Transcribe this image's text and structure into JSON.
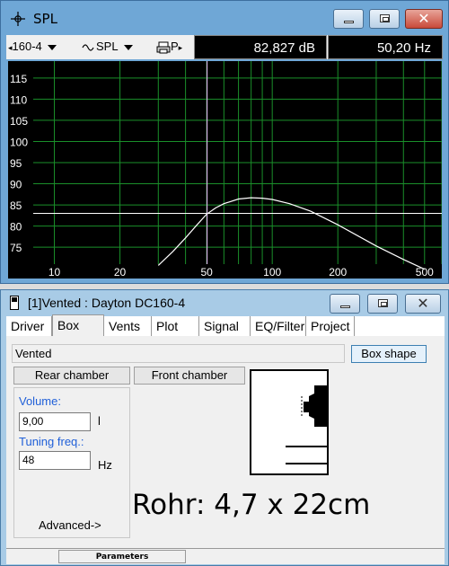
{
  "spl_window": {
    "title": "SPL",
    "toolbar": {
      "driver_select": "160-4",
      "view_select": "SPL",
      "print_label": "P",
      "spl_readout": "82,827 dB",
      "freq_readout": "50,20 Hz"
    }
  },
  "chart_data": {
    "type": "line",
    "xscale": "log",
    "xlim": [
      8,
      600
    ],
    "ylim": [
      71,
      119
    ],
    "x_ticks": [
      "10",
      "20",
      "50",
      "100",
      "200",
      "500"
    ],
    "y_ticks": [
      "115",
      "110",
      "105",
      "100",
      "95",
      "90",
      "85",
      "80",
      "75"
    ],
    "grid": true,
    "cursor_x": 50.2,
    "reference_line_y": 83,
    "series": [
      {
        "x": [
          30,
          35,
          40,
          45,
          50,
          55,
          60,
          70,
          80,
          90,
          100,
          120,
          150,
          200,
          300,
          400,
          500
        ],
        "y": [
          70.7,
          74,
          77.2,
          80.2,
          82.8,
          84.3,
          85.3,
          86.4,
          86.7,
          86.6,
          86.3,
          85.3,
          83.5,
          80.3,
          75.3,
          72.1,
          69.8
        ]
      }
    ],
    "colors": {
      "background": "#000000",
      "grid": "#1a8f2a",
      "curve": "#ffffff",
      "cursor": "#d8b4e8"
    }
  },
  "box_window": {
    "title": "[1]Vented : Dayton DC160-4",
    "tabs": [
      "Driver",
      "Box",
      "Vents",
      "Plot",
      "Signal",
      "EQ/Filter",
      "Project"
    ],
    "active_tab": "Box",
    "box_type_value": "Vented",
    "box_shape_button": "Box shape",
    "rear_chamber_button": "Rear chamber",
    "front_chamber_button": "Front chamber",
    "volume_label": "Volume:",
    "volume_value": "9,00",
    "volume_unit": "l",
    "tuning_label": "Tuning freq.:",
    "tuning_value": "48",
    "tuning_unit": "Hz",
    "advanced_button": "Advanced->",
    "annotation": "Rohr: 4,7 x 22cm",
    "status_panel": "Parameters"
  }
}
